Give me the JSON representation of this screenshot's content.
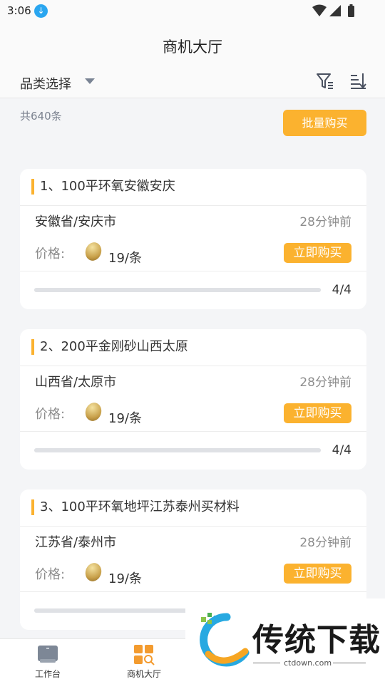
{
  "status_bar": {
    "time": "3:06"
  },
  "header": {
    "title": "商机大厅"
  },
  "filter": {
    "category_label": "品类选择"
  },
  "summary": {
    "count": "共640条",
    "batch_buy": "批量购买"
  },
  "cards": [
    {
      "title": "1、100平环氧安徽安庆",
      "location": "安徽省/安庆市",
      "time_ago": "28分钟前",
      "price_label": "价格:",
      "price": "19/条",
      "buy": "立即购买",
      "progress_text": "4/4",
      "progress": 1.0
    },
    {
      "title": "2、200平金刚砂山西太原",
      "location": "山西省/太原市",
      "time_ago": "28分钟前",
      "price_label": "价格:",
      "price": "19/条",
      "buy": "立即购买",
      "progress_text": "4/4",
      "progress": 1.0
    },
    {
      "title": "3、100平环氧地坪江苏泰州买材料",
      "location": "江苏省/泰州市",
      "time_ago": "28分钟前",
      "price_label": "价格:",
      "price": "19/条",
      "buy": "立即购买",
      "progress_text": "",
      "progress": 1.0
    }
  ],
  "tabbar": {
    "workbench": "工作台",
    "hall": "商机大厅"
  },
  "watermark": {
    "text": "传统下载",
    "url": "ctdown.com"
  },
  "colors": {
    "accent": "#fbb22f",
    "background": "#f4f5f7",
    "track": "#dfe1e5"
  }
}
